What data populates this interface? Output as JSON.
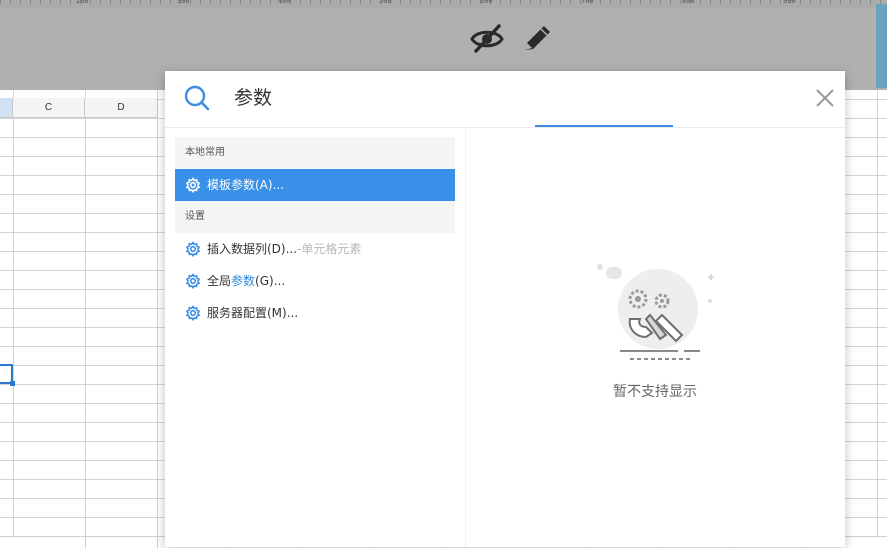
{
  "ruler": {
    "labels": [
      "200",
      "300",
      "400",
      "500",
      "600",
      "700",
      "800",
      "900"
    ]
  },
  "toolbar": {
    "icons": [
      "eye-slash-icon",
      "pencil-icon"
    ]
  },
  "sheet": {
    "columns": [
      "",
      "C",
      "D"
    ]
  },
  "dialog": {
    "search_value": "参数",
    "groups": [
      {
        "title": "本地常用",
        "items": [
          {
            "label": "模板参数(A)...",
            "icon": "gear-icon",
            "active": true
          }
        ]
      },
      {
        "title": "设置",
        "items": [
          {
            "label": "插入数据列(D)...",
            "hint": "-单元格元素",
            "icon": "gear-icon"
          },
          {
            "label_prefix": "全局",
            "label_highlight": "参数",
            "label_suffix": "(G)...",
            "icon": "gear-icon"
          },
          {
            "label": "服务器配置(M)...",
            "icon": "gear-icon"
          }
        ]
      }
    ],
    "preview_message": "暂不支持显示",
    "colors": {
      "accent": "#3890e8",
      "highlight": "#2b88e0",
      "toolbar_bg": "#b0b0b0"
    }
  }
}
